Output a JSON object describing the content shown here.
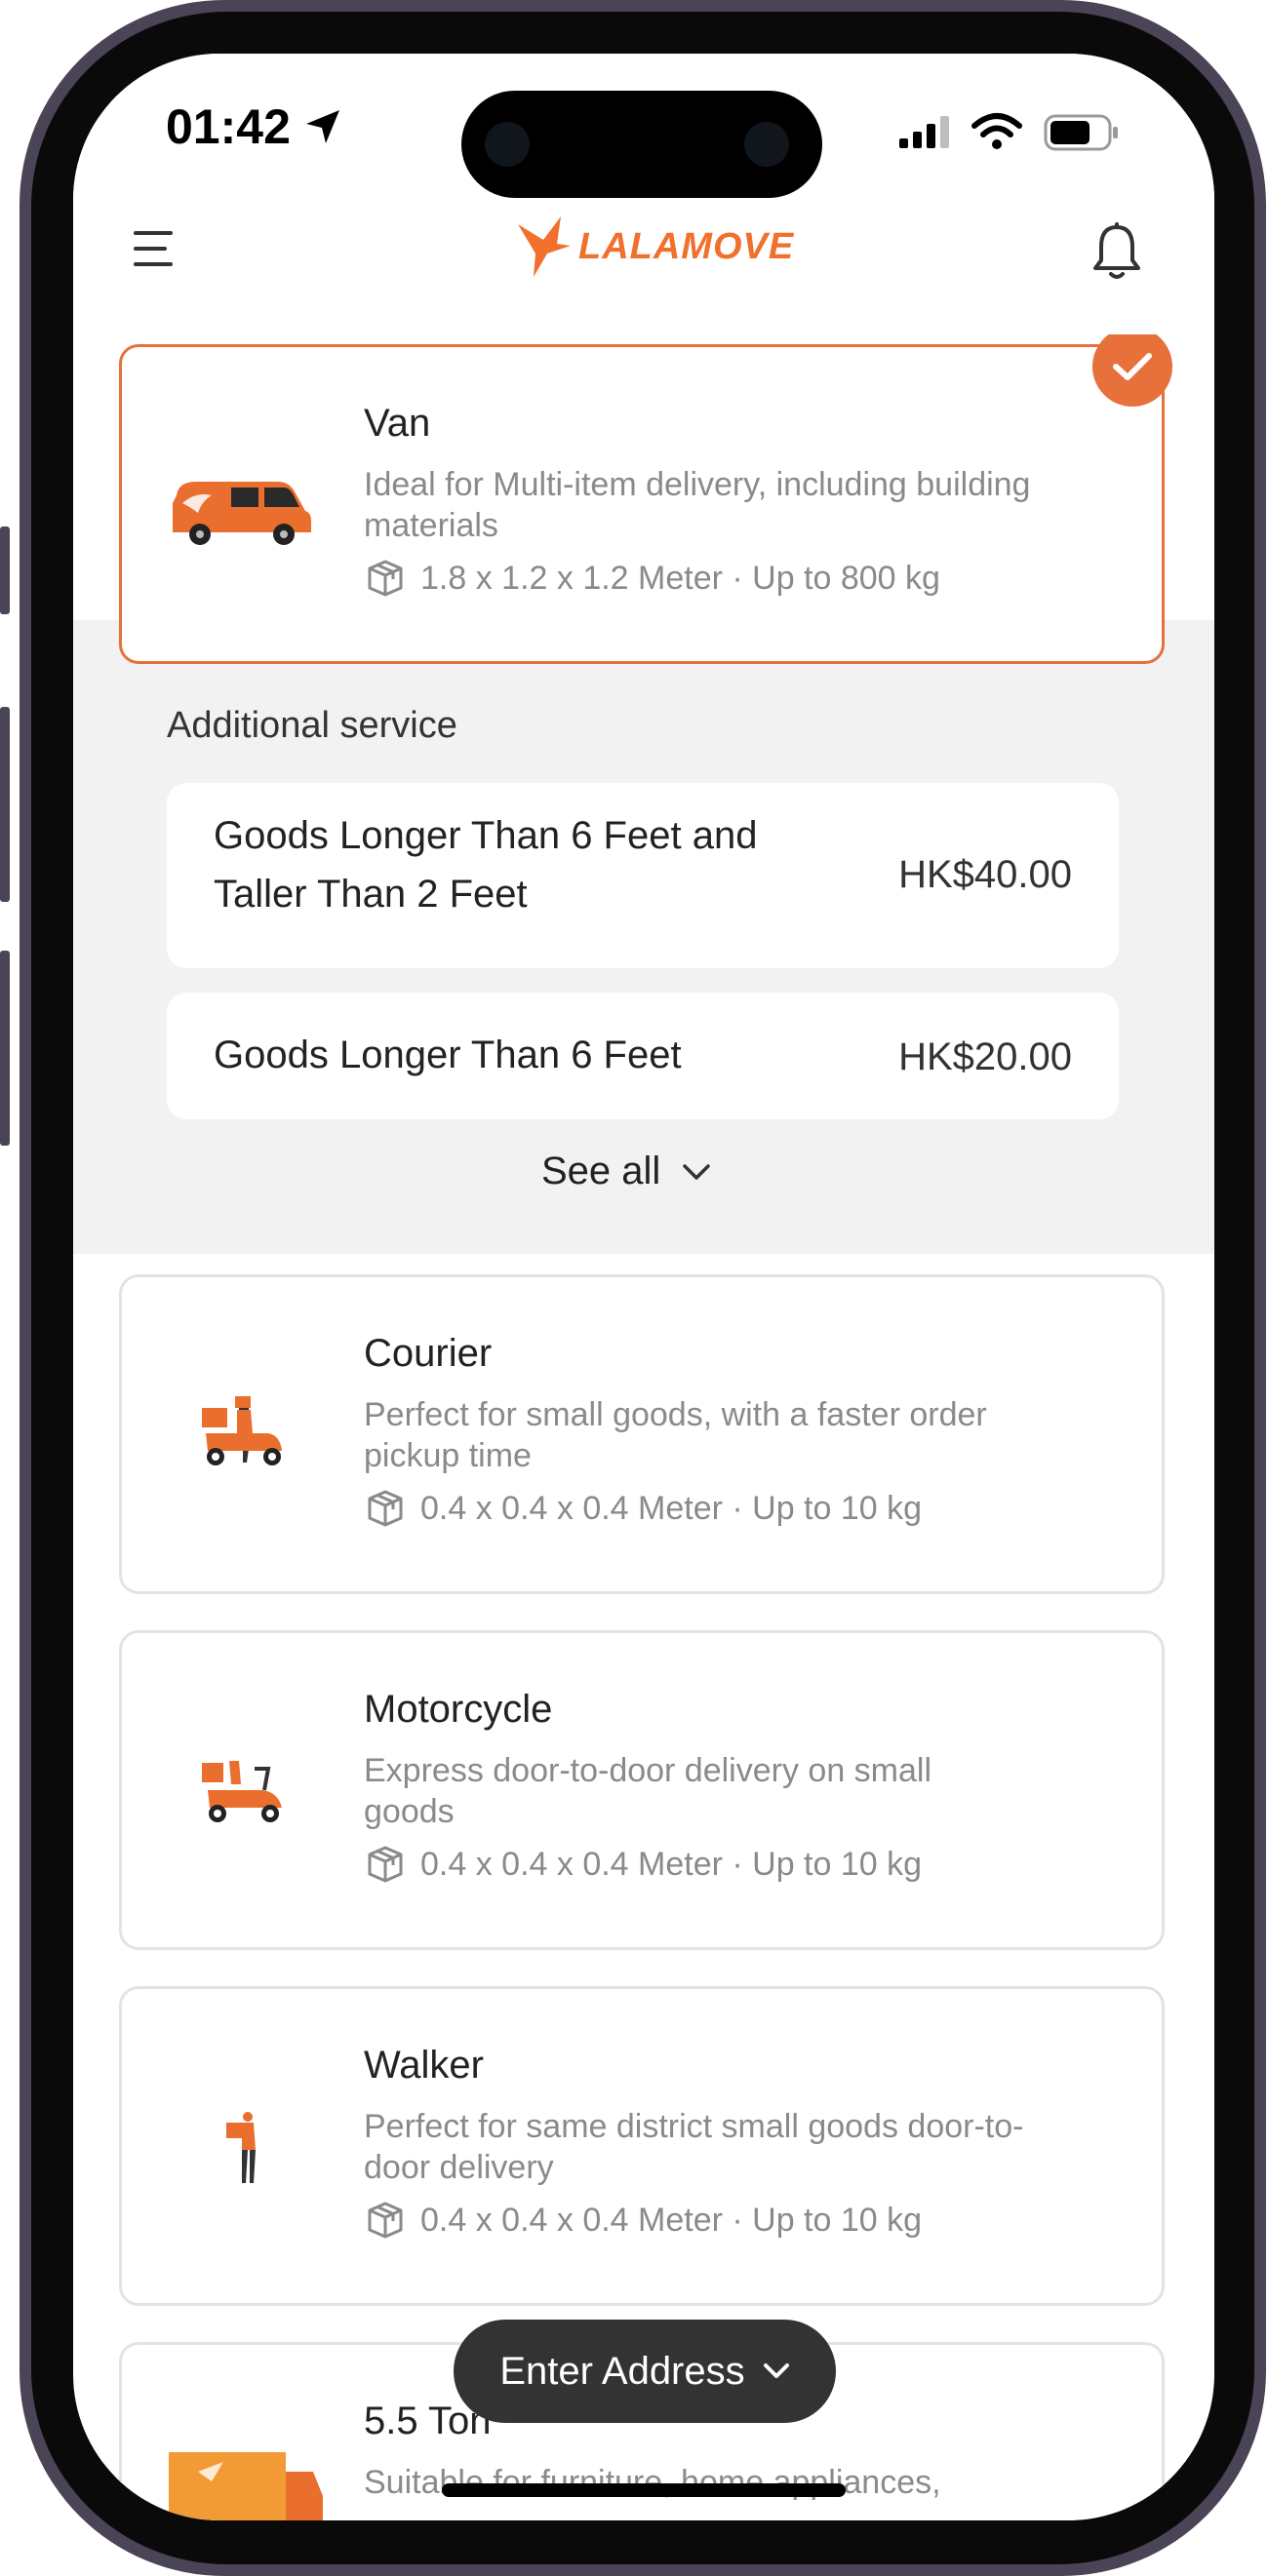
{
  "status_bar": {
    "time": "01:42"
  },
  "header": {
    "logo_text": "LALAMOVE",
    "brand_color": "#f0702c"
  },
  "selected_vehicle": {
    "title": "Van",
    "description": "Ideal for Multi-item delivery, including building materials",
    "spec": "1.8 x 1.2 x 1.2 Meter · Up to 800 kg"
  },
  "additional_service": {
    "heading": "Additional service",
    "items": [
      {
        "name": "Goods Longer Than 6 Feet and Taller Than 2 Feet",
        "price": "HK$40.00"
      },
      {
        "name": "Goods Longer Than 6 Feet",
        "price": "HK$20.00"
      }
    ],
    "see_all": "See all"
  },
  "vehicles": [
    {
      "title": "Courier",
      "description": "Perfect for small goods, with a faster order pickup time",
      "spec": "0.4 x 0.4 x 0.4 Meter · Up to 10 kg"
    },
    {
      "title": "Motorcycle",
      "description": "Express door-to-door delivery on small goods",
      "spec": "0.4 x 0.4 x 0.4 Meter · Up to 10 kg"
    },
    {
      "title": "Walker",
      "description": "Perfect for same district small goods door-to-door delivery",
      "spec": "0.4 x 0.4 x 0.4 Meter · Up to 10 kg"
    },
    {
      "title": "5.5 Ton",
      "description": "Suitable for furniture, home appliances,"
    }
  ],
  "footer": {
    "enter_address_label": "Enter Address"
  }
}
